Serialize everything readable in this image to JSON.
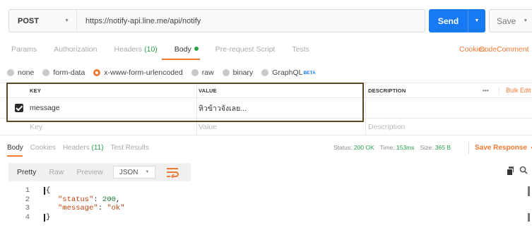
{
  "request": {
    "method": "POST",
    "url": "https://notify-api.line.me/api/notify",
    "send_label": "Send",
    "save_label": "Save"
  },
  "tabs": {
    "params": "Params",
    "authorization": "Authorization",
    "headers": "Headers",
    "headers_count": "(10)",
    "body": "Body",
    "prerequest": "Pre-request Script",
    "tests": "Tests",
    "cookies": "Cookies",
    "code": "Code",
    "comments": "Comment"
  },
  "body_types": [
    {
      "label": "none",
      "selected": false
    },
    {
      "label": "form-data",
      "selected": false
    },
    {
      "label": "x-www-form-urlencoded",
      "selected": true
    },
    {
      "label": "raw",
      "selected": false
    },
    {
      "label": "binary",
      "selected": false
    },
    {
      "label": "GraphQL",
      "selected": false
    }
  ],
  "beta_label": "BETA",
  "params_table": {
    "headers": {
      "key": "KEY",
      "value": "VALUE",
      "description": "DESCRIPTION",
      "more": "•••",
      "bulk_edit": "Bulk Edit"
    },
    "rows": [
      {
        "checked": true,
        "key": "message",
        "value": "หิวข้าวจังเลย..."
      }
    ],
    "placeholder": {
      "key": "Key",
      "value": "Value",
      "description": "Description"
    }
  },
  "response": {
    "tabs": {
      "body": "Body",
      "cookies": "Cookies",
      "headers": "Headers",
      "headers_count": "(11)",
      "test_results": "Test Results"
    },
    "status_label": "Status:",
    "status_value": "200 OK",
    "time_label": "Time:",
    "time_value": "153ms",
    "size_label": "Size:",
    "size_value": "365 B",
    "save_response": "Save Response"
  },
  "viewer": {
    "pretty": "Pretty",
    "raw": "Raw",
    "preview": "Preview",
    "format": "JSON"
  },
  "code_lines": [
    {
      "n": "1",
      "text": "{"
    },
    {
      "n": "2",
      "key": "\"status\"",
      "sep": ": ",
      "value": "200",
      "tail": ","
    },
    {
      "n": "3",
      "key": "\"message\"",
      "sep": ": ",
      "value": "\"ok\"",
      "tail": ""
    },
    {
      "n": "4",
      "text": "}"
    }
  ],
  "colors": {
    "accent": "#f07a33",
    "send": "#1879f5",
    "success": "#27a04a",
    "highlight_box": "#5d4626"
  }
}
